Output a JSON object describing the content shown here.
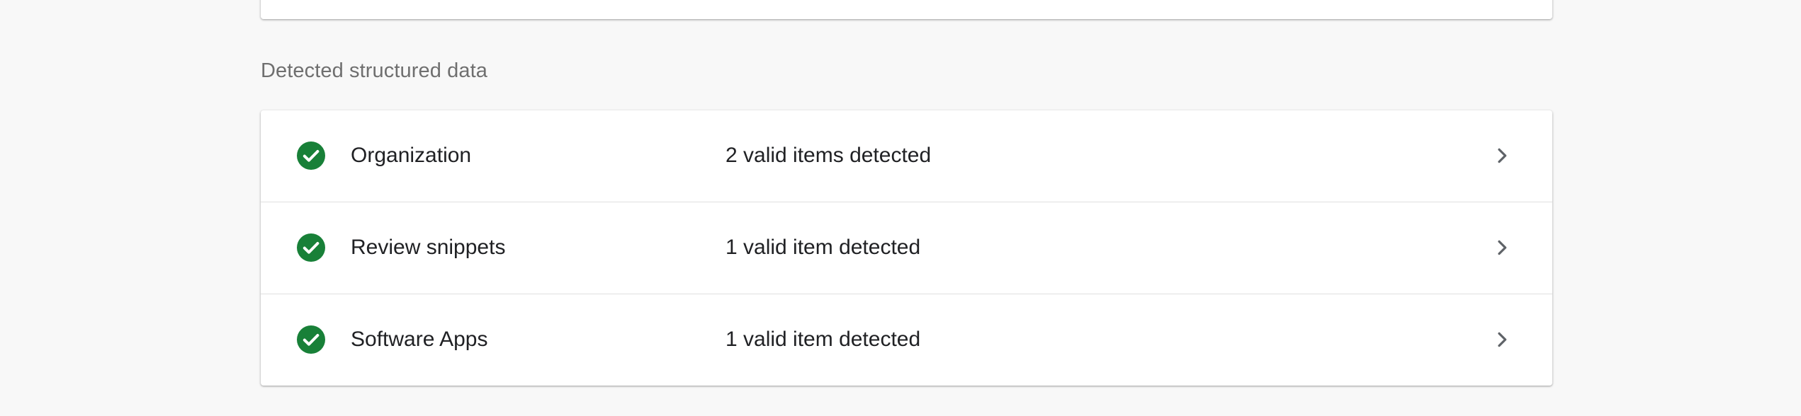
{
  "section": {
    "title": "Detected structured data"
  },
  "items": [
    {
      "name": "Organization",
      "status": "2 valid items detected",
      "state": "valid",
      "icon": "check-circle-icon",
      "action_icon": "chevron-right-icon"
    },
    {
      "name": "Review snippets",
      "status": "1 valid item detected",
      "state": "valid",
      "icon": "check-circle-icon",
      "action_icon": "chevron-right-icon"
    },
    {
      "name": "Software Apps",
      "status": "1 valid item detected",
      "state": "valid",
      "icon": "check-circle-icon",
      "action_icon": "chevron-right-icon"
    }
  ],
  "colors": {
    "page_background": "#f8f8f8",
    "card_background": "#ffffff",
    "success_green": "#188038",
    "chevron_gray": "#5f6368",
    "section_title": "#6f6f6f",
    "divider": "#e0e0e0"
  }
}
